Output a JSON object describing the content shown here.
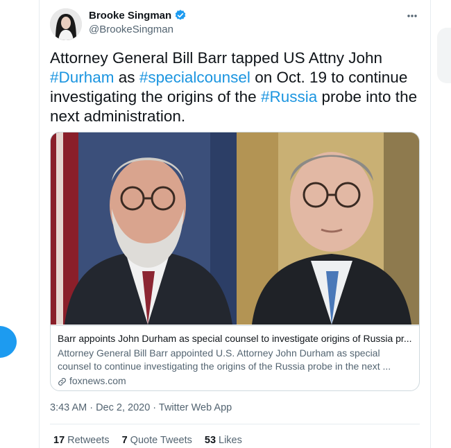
{
  "tweet": {
    "display_name": "Brooke Singman",
    "handle": "@BrookeSingman",
    "text_parts": [
      {
        "text": "Attorney General Bill Barr tapped US Attny John ",
        "hashtag": false
      },
      {
        "text": "#Durham",
        "hashtag": true
      },
      {
        "text": " as ",
        "hashtag": false
      },
      {
        "text": "#specialcounsel",
        "hashtag": true
      },
      {
        "text": " on Oct. 19 to continue investigating the origins of the ",
        "hashtag": false
      },
      {
        "text": "#Russia",
        "hashtag": true
      },
      {
        "text": " probe into the next administration.",
        "hashtag": false
      }
    ],
    "card": {
      "title": "Barr appoints John Durham as special counsel to investigate origins of Russia pr...",
      "description": "Attorney General Bill Barr appointed U.S. Attorney John Durham as special counsel to continue investigating the origins of the Russia probe in the next ...",
      "domain": "foxnews.com"
    },
    "timestamp": "3:43 AM · Dec 2, 2020 · Twitter Web App",
    "stats": {
      "retweets_count": "17",
      "retweets_label": "Retweets",
      "quotes_count": "7",
      "quotes_label": "Quote Tweets",
      "likes_count": "53",
      "likes_label": "Likes"
    }
  },
  "colors": {
    "hashtag": "#1b95e0",
    "verified": "#1d9bf0",
    "secondary_text": "#536471",
    "border": "#cfd9de"
  },
  "icons": {
    "verified": "verified-badge-icon",
    "more": "more-options-icon",
    "link": "link-icon"
  }
}
